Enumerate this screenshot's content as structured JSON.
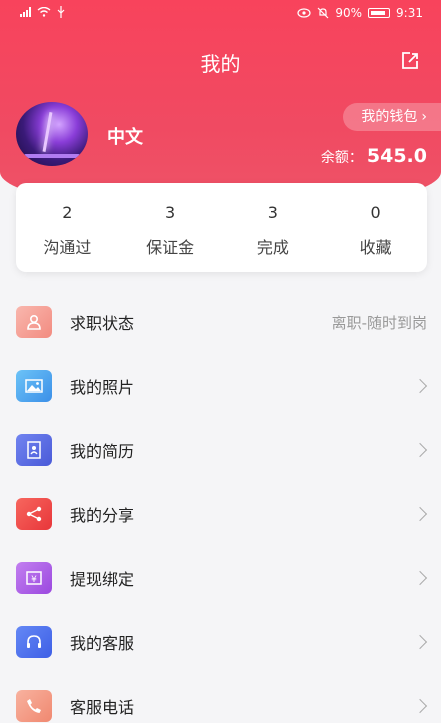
{
  "status_bar": {
    "battery": "90%",
    "time": "9:31"
  },
  "header": {
    "title": "我的"
  },
  "profile": {
    "name": "中文",
    "wallet_label": "我的钱包",
    "balance_label": "余额：",
    "balance_value": "545.0"
  },
  "stats": [
    {
      "value": "2",
      "label": "沟通过"
    },
    {
      "value": "3",
      "label": "保证金"
    },
    {
      "value": "3",
      "label": "完成"
    },
    {
      "value": "0",
      "label": "收藏"
    }
  ],
  "menu": [
    {
      "label": "求职状态",
      "value": "离职-随时到岗",
      "icon": "person-icon",
      "color": "#f7a7a0"
    },
    {
      "label": "我的照片",
      "value": "",
      "icon": "photo-icon",
      "color": "#4ea8f2"
    },
    {
      "label": "我的简历",
      "value": "",
      "icon": "resume-icon",
      "color": "#5b6fe6"
    },
    {
      "label": "我的分享",
      "value": "",
      "icon": "share-nodes-icon",
      "color": "#ef4a4a"
    },
    {
      "label": "提现绑定",
      "value": "",
      "icon": "withdraw-icon",
      "color": "#b066e8"
    },
    {
      "label": "我的客服",
      "value": "",
      "icon": "headset-icon",
      "color": "#4b6ef0"
    },
    {
      "label": "客服电话",
      "value": "",
      "icon": "phone-icon",
      "color": "#f59a86"
    }
  ]
}
